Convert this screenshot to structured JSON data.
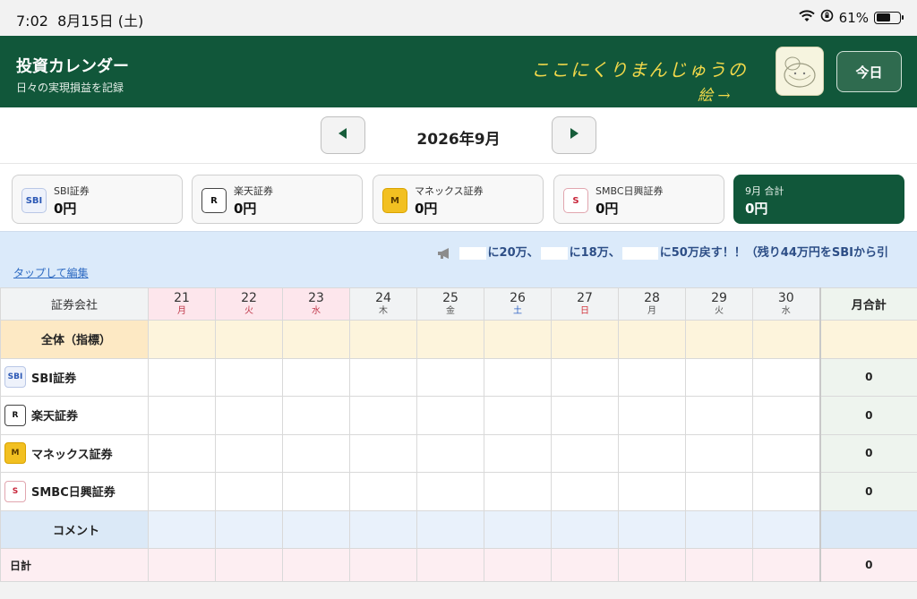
{
  "status": {
    "time": "7:02",
    "date": "8月15日 (土)",
    "battery": "61%",
    "battery_level": 0.61
  },
  "header": {
    "title": "投資カレンダー",
    "subtitle": "日々の実現損益を記録",
    "note_line1": "ここにくりまんじゅうの",
    "note_line2": "絵 →",
    "today_label": "今日"
  },
  "month": {
    "label": "2026年9月",
    "prev_icon": "triangle-left-icon",
    "next_icon": "triangle-right-icon"
  },
  "cards": [
    {
      "name": "SBI証券",
      "value": "0円",
      "logo": "sbi-logo"
    },
    {
      "name": "楽天証券",
      "value": "0円",
      "logo": "rakuten-logo"
    },
    {
      "name": "マネックス証券",
      "value": "0円",
      "logo": "monex-logo"
    },
    {
      "name": "SMBC日興証券",
      "value": "0円",
      "logo": "smbc-logo"
    }
  ],
  "total_card": {
    "name": "9月 合計",
    "value": "0円"
  },
  "banner": {
    "part1": "に20万、",
    "part2": "に18万、",
    "part3": "に50万戻す！！（残り44万円をSBIから引",
    "edit_label": "タップして編集"
  },
  "table": {
    "corner": "証券会社",
    "month_total": "月合計",
    "days": [
      {
        "d": "21",
        "w": "月"
      },
      {
        "d": "22",
        "w": "火"
      },
      {
        "d": "23",
        "w": "水"
      },
      {
        "d": "24",
        "w": "木"
      },
      {
        "d": "25",
        "w": "金"
      },
      {
        "d": "26",
        "w": "土"
      },
      {
        "d": "27",
        "w": "日"
      },
      {
        "d": "28",
        "w": "月"
      },
      {
        "d": "29",
        "w": "火"
      },
      {
        "d": "30",
        "w": "水"
      }
    ],
    "overall_label": "全体（指標）",
    "brokers": [
      {
        "name": "SBI証券",
        "total": "0"
      },
      {
        "name": "楽天証券",
        "total": "0"
      },
      {
        "name": "マネックス証券",
        "total": "0"
      },
      {
        "name": "SMBC日興証券",
        "total": "0"
      }
    ],
    "comment_label": "コメント",
    "daily_label": "日計",
    "daily_total": "0"
  },
  "colors": {
    "header_green": "#11573a",
    "banner_blue": "#dbeafa",
    "weekend_blue": "#2f63c3",
    "sunday_red": "#d3363e"
  }
}
